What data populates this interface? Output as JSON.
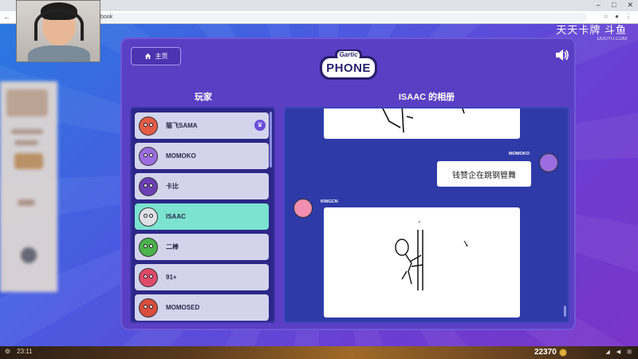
{
  "browser": {
    "url": "/book",
    "window_buttons": [
      "–",
      "□",
      "✕"
    ],
    "nav_icons": [
      "back-icon",
      "forward-icon",
      "reload-icon"
    ]
  },
  "watermark": {
    "line1": "天天卡牌 斗鱼",
    "line2": "DOUYU.COM"
  },
  "header": {
    "home_label": "主页",
    "logo_top": "Gartic",
    "logo_main": "PHONE"
  },
  "players_panel": {
    "title": "玩家",
    "players": [
      {
        "name": "猫飞SAMA",
        "color": "#e35b47",
        "host": true,
        "active": false
      },
      {
        "name": "MOMOKO",
        "color": "#9b6de0",
        "host": false,
        "active": false
      },
      {
        "name": "卡比",
        "color": "#6b3fb5",
        "host": false,
        "active": false
      },
      {
        "name": "ISAAC",
        "color": "#e0e0e8",
        "host": false,
        "active": true
      },
      {
        "name": "二棒",
        "color": "#4bb34b",
        "host": false,
        "active": false
      },
      {
        "name": "91+",
        "color": "#e04a6a",
        "host": false,
        "active": false
      },
      {
        "name": "MOMOSED",
        "color": "#d94d3d",
        "host": false,
        "active": false
      }
    ],
    "crown_icon": "crown-icon"
  },
  "album": {
    "title": "ISAAC 的相册",
    "entries": [
      {
        "type": "drawing",
        "author": ""
      },
      {
        "type": "text",
        "author": "MOMOKO",
        "text": "钱赞企在跳钢管舞"
      },
      {
        "type": "drawing",
        "author": "KINGCN"
      }
    ]
  },
  "bottom_bar": {
    "time": "23:11",
    "gold": "22370",
    "system_icons": [
      "network-icon",
      "volume-icon",
      "language-icon"
    ]
  }
}
